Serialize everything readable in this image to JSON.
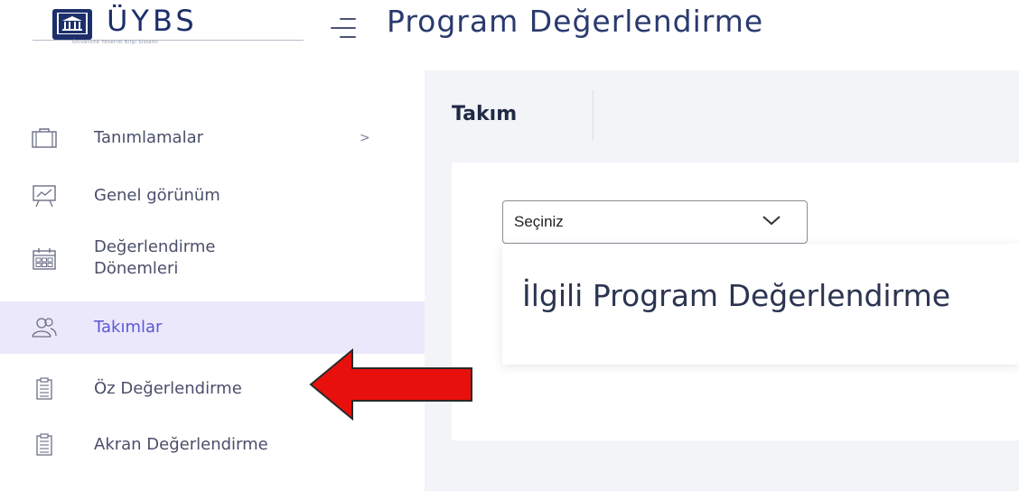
{
  "header": {
    "logo_text": "ÜYBS",
    "logo_subtitle": "Üniversite Yönetim Bilgi Sistemi",
    "page_title": "Program Değerlendirme"
  },
  "sidebar": {
    "items": [
      {
        "label": "Tanımlamalar",
        "icon": "briefcase-icon",
        "chevron": ">"
      },
      {
        "label": "Genel görünüm",
        "icon": "chart-board-icon"
      },
      {
        "label_line1": "Değerlendirme",
        "label_line2": "Dönemleri",
        "icon": "calendar-icon"
      },
      {
        "label": "Takımlar",
        "icon": "team-icon",
        "active": true
      },
      {
        "label": "Öz Değerlendirme",
        "icon": "clipboard-icon"
      },
      {
        "label": "Akran Değerlendirme",
        "icon": "clipboard-icon"
      }
    ]
  },
  "main": {
    "tab_title": "Takım",
    "select": {
      "value": "Seçiniz"
    },
    "heading": "İlgili Program Değerlendirme"
  },
  "colors": {
    "brand": "#1c2f6b",
    "active_bg": "#ebe8fb",
    "accent": "#5d56d6",
    "arrow": "#e8100c"
  }
}
